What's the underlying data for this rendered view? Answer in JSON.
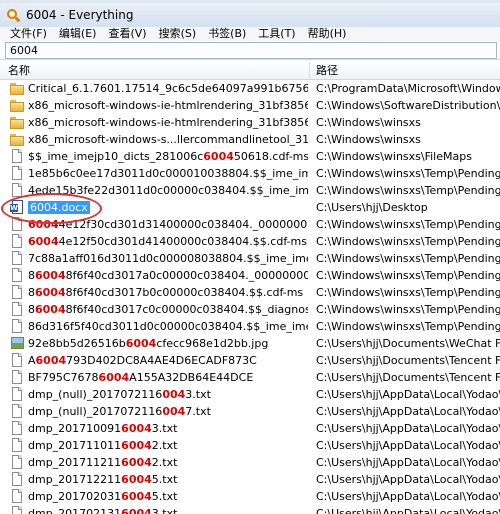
{
  "window": {
    "title": "6004 - Everything"
  },
  "menu": [
    {
      "label": "文件(F)"
    },
    {
      "label": "编辑(E)"
    },
    {
      "label": "查看(V)"
    },
    {
      "label": "搜索(S)"
    },
    {
      "label": "书签(B)"
    },
    {
      "label": "工具(T)"
    },
    {
      "label": "帮助(H)"
    }
  ],
  "search": {
    "value": "6004"
  },
  "columns": {
    "name": "名称",
    "path": "路径"
  },
  "rows": [
    {
      "icon": "folder-icon",
      "name_pre": "Critical_6.1.7601.17514_9c6c5de64097a991b6756a8c7ec590",
      "name_hl": "",
      "name_post": "",
      "path": "C:\\ProgramData\\Microsoft\\Windows\\W"
    },
    {
      "icon": "folder-icon",
      "name_pre": "x86_microsoft-windows-ie-htmlrendering_31bf3856ad364e3",
      "name_hl": "",
      "name_post": "",
      "path": "C:\\Windows\\SoftwareDistribution\\Down"
    },
    {
      "icon": "folder-icon",
      "name_pre": "x86_microsoft-windows-ie-htmlrendering_31bf3856ad364e3",
      "name_hl": "",
      "name_post": "",
      "path": "C:\\Windows\\winsxs"
    },
    {
      "icon": "folder-icon",
      "name_pre": "x86_microsoft-windows-s...llercommandlinetool_31bf3856ad",
      "name_hl": "",
      "name_post": "",
      "path": "C:\\Windows\\winsxs"
    },
    {
      "icon": "file-icon",
      "name_pre": "$$_ime_imejp10_dicts_281006c",
      "name_hl": "6004",
      "name_post": "50618.cdf-ms",
      "path": "C:\\Windows\\winsxs\\FileMaps"
    },
    {
      "icon": "file-icon",
      "name_pre": "1e85b6c0ee17d3011d0c000010038804.$$_ime_imejp10_dict",
      "name_hl": "",
      "name_post": "",
      "path": "C:\\Windows\\winsxs\\Temp\\PendingRena"
    },
    {
      "icon": "file-icon",
      "name_pre": "4ede15b3fe22d3011d0c00000c038404.$$_ime_imejp10_dict",
      "name_hl": "",
      "name_post": "",
      "path": "C:\\Windows\\winsxs\\Temp\\PendingRena"
    },
    {
      "icon": "docx-icon",
      "name_pre": "",
      "name_hl": "6004",
      "name_post": ".docx",
      "path": "C:\\Users\\hjj\\Desktop",
      "selected": true
    },
    {
      "icon": "file-icon",
      "name_pre": "",
      "name_hl": "6004",
      "name_post": "4e12f30cd301d31400000c038404._000000000000000000",
      "path": "C:\\Windows\\winsxs\\Temp\\PendingRena"
    },
    {
      "icon": "file-icon",
      "name_pre": "",
      "name_hl": "6004",
      "name_post": "4e12f50cd301d41400000c038404.$$.cdf-ms",
      "path": "C:\\Windows\\winsxs\\Temp\\PendingRena"
    },
    {
      "icon": "file-icon",
      "name_pre": "7c88a1aff016d3011d0c000008038804.$$_ime_imejp10_dicts",
      "name_hl": "",
      "name_post": "",
      "path": "C:\\Windows\\winsxs\\Temp\\PendingRena"
    },
    {
      "icon": "file-icon",
      "name_pre": "8",
      "name_hl": "6004",
      "name_post": "8f6f40cd3017a0c00000c038404._000000000000000000",
      "path": "C:\\Windows\\winsxs\\Temp\\PendingRena"
    },
    {
      "icon": "file-icon",
      "name_pre": "8",
      "name_hl": "6004",
      "name_post": "8f6f40cd3017b0c00000c038404.$$.cdf-ms",
      "path": "C:\\Windows\\winsxs\\Temp\\PendingRena"
    },
    {
      "icon": "file-icon",
      "name_pre": "8",
      "name_hl": "6004",
      "name_post": "8f6f40cd3017c0c00000c038404.$$_diagnostics_syste",
      "path": "C:\\Windows\\winsxs\\Temp\\PendingRena"
    },
    {
      "icon": "file-icon",
      "name_pre": "86d316f5f40cd3011d0c00000c038404.$$_ime_imejp10_dict",
      "name_hl": "",
      "name_post": "",
      "path": "C:\\Windows\\winsxs\\Temp\\PendingRena"
    },
    {
      "icon": "image-icon",
      "name_pre": "92e8bb5d26516b",
      "name_hl": "6004",
      "name_post": "cfecc968e1d2bb.jpg",
      "path": "C:\\Users\\hjj\\Documents\\WeChat Files\\h"
    },
    {
      "icon": "file-icon",
      "name_pre": "A",
      "name_hl": "6004",
      "name_post": "793D402DC8A4AE4D6ECADF873C",
      "path": "C:\\Users\\hjj\\Documents\\Tencent Files\\4"
    },
    {
      "icon": "file-icon",
      "name_pre": "BF795C7678",
      "name_hl": "6004",
      "name_post": "A155A32DB64E44DCE",
      "path": "C:\\Users\\hjj\\Documents\\Tencent Files\\4"
    },
    {
      "icon": "file-icon",
      "name_pre": "dmp_(null)_2017072116",
      "name_hl": "004",
      "name_post": "3.txt",
      "path": "C:\\Users\\hjj\\AppData\\Local\\Yodao\\Des"
    },
    {
      "icon": "file-icon",
      "name_pre": "dmp_(null)_2017072116",
      "name_hl": "004",
      "name_post": "7.txt",
      "path": "C:\\Users\\hjj\\AppData\\Local\\Yodao\\Des"
    },
    {
      "icon": "file-icon",
      "name_pre": "dmp_201710091",
      "name_hl": "6004",
      "name_post": "3.txt",
      "path": "C:\\Users\\hjj\\AppData\\Local\\Yodao\\Des"
    },
    {
      "icon": "file-icon",
      "name_pre": "dmp_201711011",
      "name_hl": "6004",
      "name_post": "2.txt",
      "path": "C:\\Users\\hjj\\AppData\\Local\\Yodao\\Des"
    },
    {
      "icon": "file-icon",
      "name_pre": "dmp_201711211",
      "name_hl": "6004",
      "name_post": "2.txt",
      "path": "C:\\Users\\hjj\\AppData\\Local\\Yodao\\Des"
    },
    {
      "icon": "file-icon",
      "name_pre": "dmp_201712211",
      "name_hl": "6004",
      "name_post": "5.txt",
      "path": "C:\\Users\\hjj\\AppData\\Local\\Yodao\\Des"
    },
    {
      "icon": "file-icon",
      "name_pre": "dmp_201702031",
      "name_hl": "6004",
      "name_post": "5.txt",
      "path": "C:\\Users\\hjj\\AppData\\Local\\Yodao\\Des"
    },
    {
      "icon": "file-icon",
      "name_pre": "dmp_201702131",
      "name_hl": "6004",
      "name_post": "3.txt",
      "path": "C:\\Users\\hjj\\AppData\\Local\\Yodao\\Des"
    }
  ]
}
